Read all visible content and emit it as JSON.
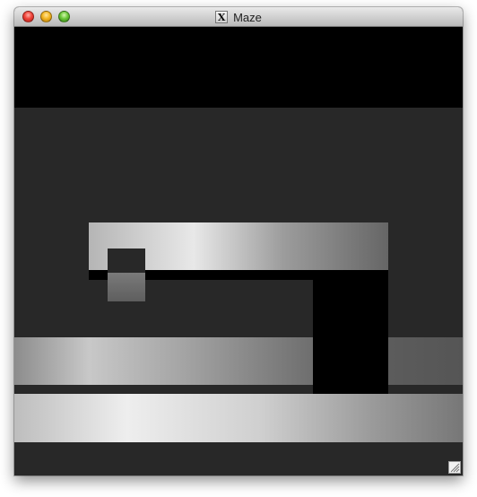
{
  "window": {
    "title": "Maze",
    "app_icon": "x11-icon",
    "title_icon_glyph": "X"
  },
  "colors": {
    "ceiling": "#000000",
    "floor": "#282828",
    "wall_light": "#ececec",
    "wall_dark": "#5e5e5e"
  }
}
